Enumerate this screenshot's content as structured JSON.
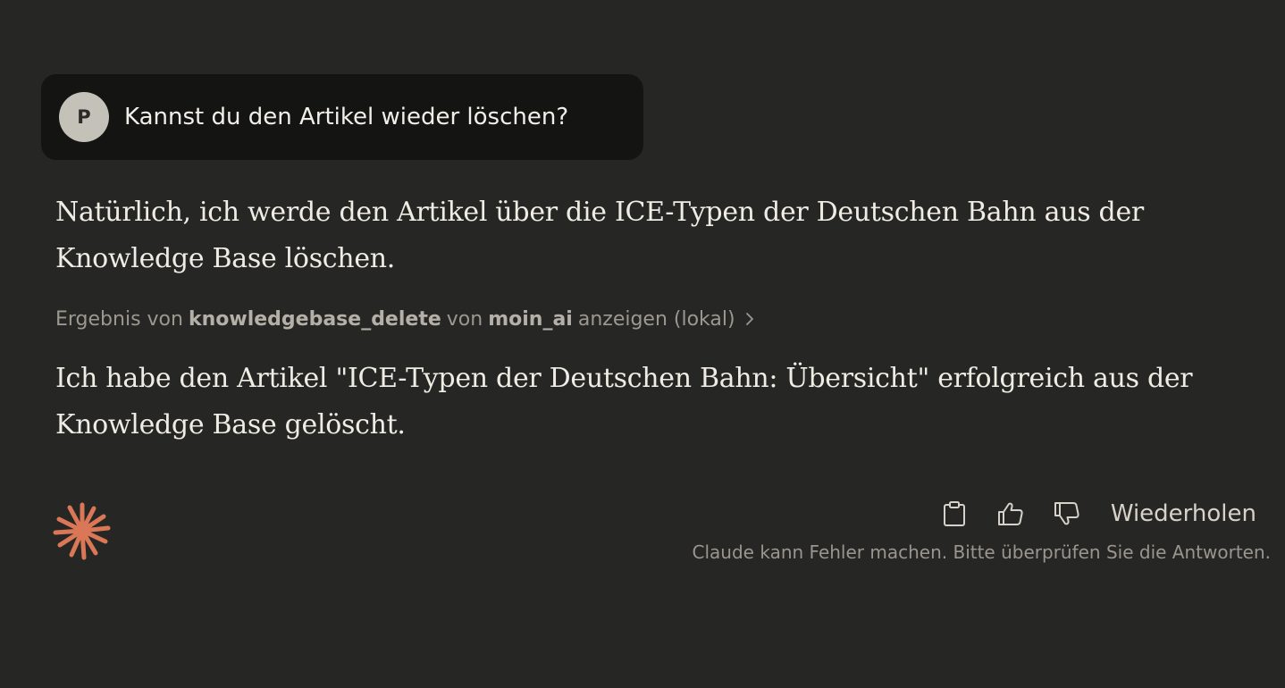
{
  "user_message": {
    "avatar_initial": "P",
    "text": "Kannst du den Artikel wieder löschen?"
  },
  "assistant": {
    "paragraph_1": "Natürlich, ich werde den Artikel über die ICE-Typen der Deutschen Bahn aus der Knowledge Base löschen.",
    "tool_result": {
      "prefix": "Ergebnis von",
      "tool_name": "knowledgebase_delete",
      "middle": "von",
      "server_name": "moin_ai",
      "suffix": "anzeigen (lokal)"
    },
    "paragraph_2": "Ich habe den Artikel \"ICE-Typen der Deutschen Bahn: Übersicht\" erfolgreich aus der Knowledge Base gelöscht."
  },
  "actions": {
    "copy_icon": "clipboard-icon",
    "thumbs_up_icon": "thumbs-up-icon",
    "thumbs_down_icon": "thumbs-down-icon",
    "retry_label": "Wiederholen"
  },
  "disclaimer": "Claude kann Fehler machen. Bitte überprüfen Sie die Antworten.",
  "colors": {
    "background": "#262624",
    "user_bubble": "#141413",
    "accent_spark": "#d97757"
  }
}
